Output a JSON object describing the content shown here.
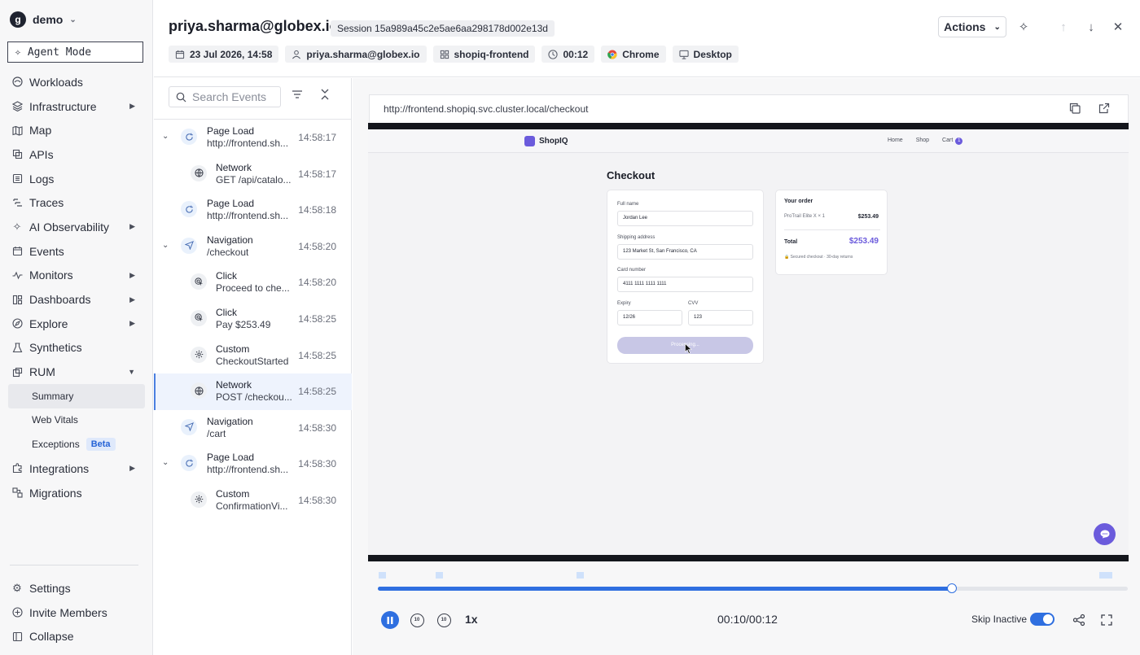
{
  "sidebar": {
    "org_name": "demo",
    "org_logo": "g",
    "agent_mode": "Agent Mode",
    "items": [
      {
        "label": "Workloads",
        "icon": "workloads-icon"
      },
      {
        "label": "Infrastructure",
        "icon": "layers-icon",
        "expandable": true
      },
      {
        "label": "Map",
        "icon": "map-icon"
      },
      {
        "label": "APIs",
        "icon": "api-icon"
      },
      {
        "label": "Logs",
        "icon": "logs-icon"
      },
      {
        "label": "Traces",
        "icon": "traces-icon"
      },
      {
        "label": "AI Observability",
        "icon": "sparkle-icon",
        "expandable": true
      },
      {
        "label": "Events",
        "icon": "calendar-icon"
      },
      {
        "label": "Monitors",
        "icon": "pulse-icon",
        "expandable": true
      },
      {
        "label": "Dashboards",
        "icon": "dashboard-icon",
        "expandable": true
      },
      {
        "label": "Explore",
        "icon": "compass-icon",
        "expandable": true
      },
      {
        "label": "Synthetics",
        "icon": "flask-icon"
      },
      {
        "label": "RUM",
        "icon": "rum-icon",
        "expanded": true
      }
    ],
    "rum_sub": [
      {
        "label": "Summary",
        "active": true
      },
      {
        "label": "Web Vitals"
      },
      {
        "label": "Exceptions",
        "badge": "Beta"
      }
    ],
    "items_after": [
      {
        "label": "Integrations",
        "icon": "puzzle-icon",
        "expandable": true
      },
      {
        "label": "Migrations",
        "icon": "migrate-icon"
      }
    ],
    "bottom": [
      {
        "label": "Settings",
        "icon": "gear-icon"
      },
      {
        "label": "Invite Members",
        "icon": "plus-circle-icon"
      },
      {
        "label": "Collapse",
        "icon": "collapse-icon"
      }
    ]
  },
  "header": {
    "title": "priya.sharma@globex.io",
    "session": "Session 15a989a45c2e5ae6aa298178d002e13d",
    "chips": [
      {
        "label": "23 Jul 2026, 14:58",
        "icon": "calendar-icon"
      },
      {
        "label": "priya.sharma@globex.io",
        "icon": "user-icon"
      },
      {
        "label": "shopiq-frontend",
        "icon": "grid-icon"
      },
      {
        "label": "00:12",
        "icon": "clock-icon"
      },
      {
        "label": "Chrome",
        "icon": "chrome-icon"
      },
      {
        "label": "Desktop",
        "icon": "monitor-icon"
      }
    ],
    "actions_label": "Actions"
  },
  "events": {
    "search_placeholder": "Search Events",
    "items": [
      {
        "title": "Page Load",
        "sub": "http://frontend.sh...",
        "time": "14:58:17",
        "icon": "reload-icon",
        "caret": true,
        "indent": 0
      },
      {
        "title": "Network",
        "sub": "GET /api/catalo...",
        "time": "14:58:17",
        "icon": "globe-icon",
        "indent": 1
      },
      {
        "title": "Page Load",
        "sub": "http://frontend.sh...",
        "time": "14:58:18",
        "icon": "reload-icon",
        "indent": 0
      },
      {
        "title": "Navigation",
        "sub": "/checkout",
        "time": "14:58:20",
        "icon": "navigation-icon",
        "caret": true,
        "indent": 0
      },
      {
        "title": "Click",
        "sub": "Proceed to che...",
        "time": "14:58:20",
        "icon": "click-icon",
        "indent": 1
      },
      {
        "title": "Click",
        "sub": "Pay $253.49",
        "time": "14:58:25",
        "icon": "click-icon",
        "indent": 1
      },
      {
        "title": "Custom",
        "sub": "CheckoutStarted",
        "time": "14:58:25",
        "icon": "gear-icon",
        "indent": 1
      },
      {
        "title": "Network",
        "sub": "POST /checkou...",
        "time": "14:58:25",
        "icon": "globe-icon",
        "indent": 1,
        "selected": true
      },
      {
        "title": "Navigation",
        "sub": "/cart",
        "time": "14:58:30",
        "icon": "navigation-icon",
        "indent": 0
      },
      {
        "title": "Page Load",
        "sub": "http://frontend.sh...",
        "time": "14:58:30",
        "icon": "reload-icon",
        "caret": true,
        "indent": 0
      },
      {
        "title": "Custom",
        "sub": "ConfirmationVi...",
        "time": "14:58:30",
        "icon": "gear-icon",
        "indent": 1
      }
    ]
  },
  "player": {
    "url": "http://frontend.shopiq.svc.cluster.local/checkout",
    "replay": {
      "brand": "ShopIQ",
      "nav": [
        "Home",
        "Shop",
        "Cart"
      ],
      "cart_count": "1",
      "heading": "Checkout",
      "fields": [
        {
          "label": "Full name",
          "value": "Jordan Lee"
        },
        {
          "label": "Shipping address",
          "value": "123 Market St, San Francisco, CA"
        },
        {
          "label": "Card number",
          "value": "4111 1111 1111 1111"
        }
      ],
      "expiry_label": "Expiry",
      "expiry_value": "12/26",
      "cvv_label": "CVV",
      "cvv_value": "123",
      "button_label": "Processing...",
      "order_title": "Your order",
      "order_item": "ProTrail Elite X × 1",
      "order_item_price": "$253.49",
      "total_label": "Total",
      "total_value": "$253.49",
      "order_note": "🔒 Secured checkout · 30-day returns"
    },
    "progress_fraction": 0.766,
    "speed": "1x",
    "time": "00:10/00:12",
    "skip_label": "Skip Inactive",
    "skip_enabled": true,
    "accent_color": "#2f6fe0"
  }
}
